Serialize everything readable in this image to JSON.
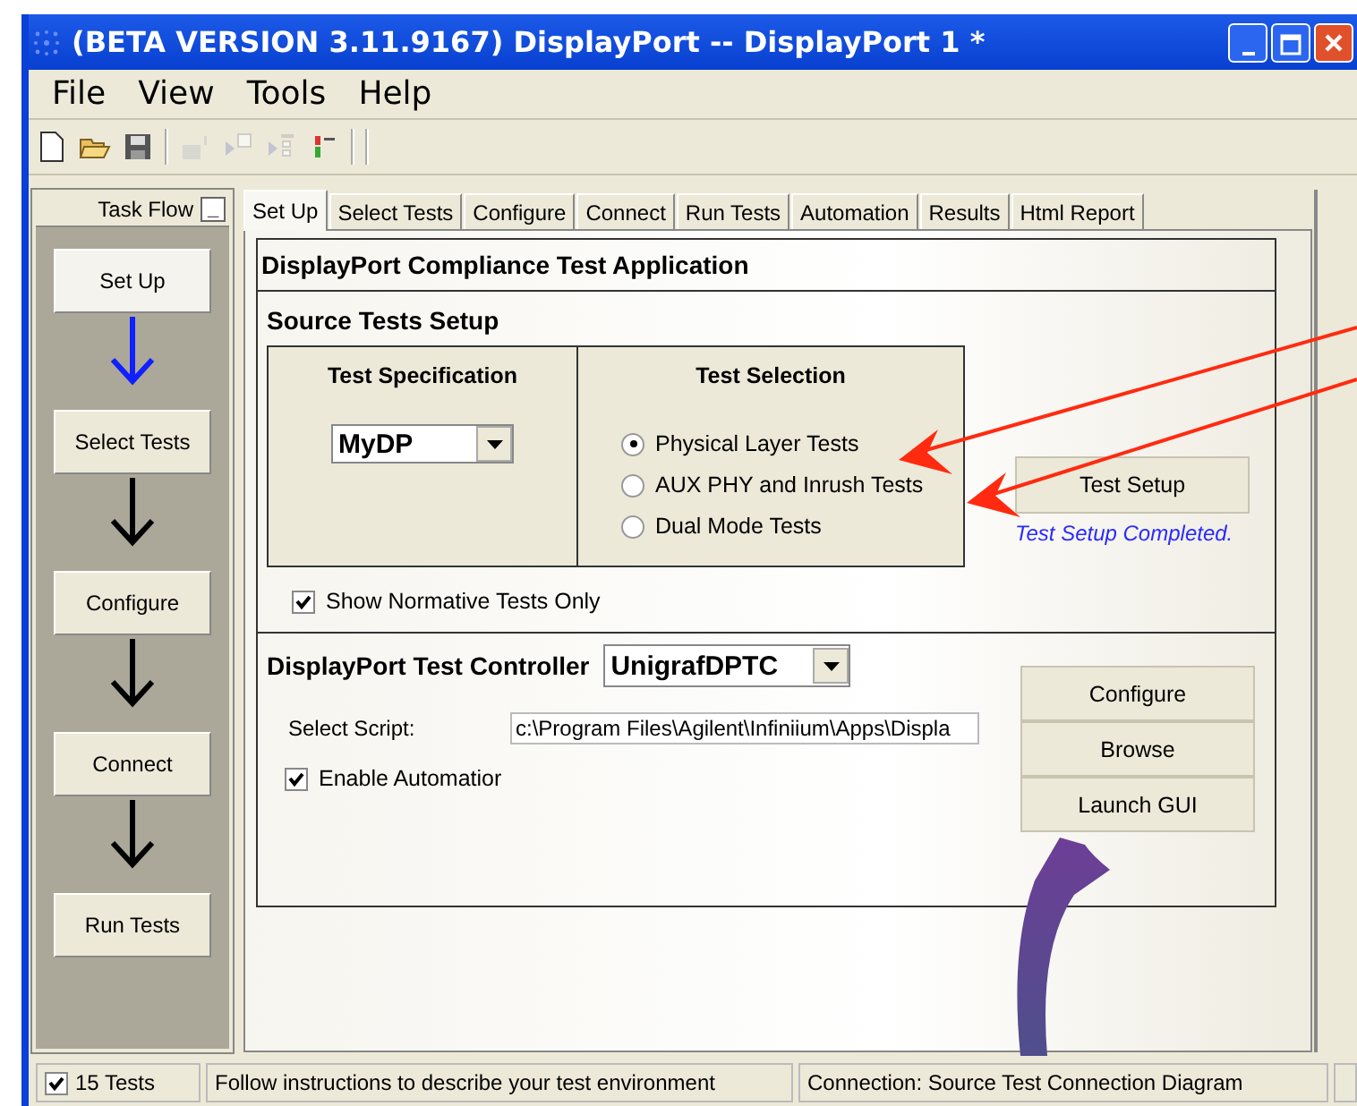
{
  "window": {
    "title": "(BETA VERSION 3.11.9167) DisplayPort -- DisplayPort 1 *"
  },
  "menu": [
    "File",
    "View",
    "Tools",
    "Help"
  ],
  "toolbar": [
    {
      "kind": "new",
      "disabled": false
    },
    {
      "kind": "open",
      "disabled": false
    },
    {
      "kind": "save",
      "disabled": false
    },
    {
      "kind": "chart",
      "disabled": true
    },
    {
      "kind": "check",
      "disabled": true
    },
    {
      "kind": "list",
      "disabled": true
    },
    {
      "kind": "bars",
      "disabled": false
    }
  ],
  "task_flow": {
    "title": "Task Flow",
    "minimize": "_",
    "steps": [
      {
        "label": "Set Up",
        "selected": true
      },
      {
        "label": "Select Tests",
        "selected": false
      },
      {
        "label": "Configure",
        "selected": false
      },
      {
        "label": "Connect",
        "selected": false
      },
      {
        "label": "Run Tests",
        "selected": false
      }
    ]
  },
  "tabs": [
    {
      "label": "Set Up",
      "selected": true
    },
    {
      "label": "Select Tests",
      "selected": false
    },
    {
      "label": "Configure",
      "selected": false
    },
    {
      "label": "Connect",
      "selected": false
    },
    {
      "label": "Run Tests",
      "selected": false
    },
    {
      "label": "Automation",
      "selected": false
    },
    {
      "label": "Results",
      "selected": false
    },
    {
      "label": "Html Report",
      "selected": false
    }
  ],
  "heading": "DisplayPort Compliance Test Application",
  "source_setup": {
    "title": "Source Tests Setup",
    "spec_title": "Test Specification",
    "spec_value": "MyDP",
    "selection_title": "Test Selection",
    "options": [
      {
        "label": "Physical Layer Tests",
        "selected": true
      },
      {
        "label": "AUX PHY and Inrush Tests",
        "selected": false
      },
      {
        "label": "Dual Mode Tests",
        "selected": false
      }
    ],
    "test_setup_button": "Test Setup",
    "setup_status": "Test Setup Completed.",
    "normative": {
      "label": "Show Normative Tests Only",
      "checked": true
    }
  },
  "controller": {
    "title": "DisplayPort Test Controller",
    "value": "UnigrafDPTC",
    "script_label": "Select Script:",
    "script_value": "c:\\Program Files\\Agilent\\Infiniium\\Apps\\Displa",
    "automation": {
      "label": "Enable Automatior",
      "checked": true
    },
    "buttons": [
      "Configure",
      "Browse",
      "Launch GUI"
    ]
  },
  "status_bar": {
    "tests": {
      "label": "15 Tests",
      "checked": true
    },
    "message": "Follow instructions to describe your test environment",
    "connection": "Connection: Source Test Connection Diagram"
  }
}
